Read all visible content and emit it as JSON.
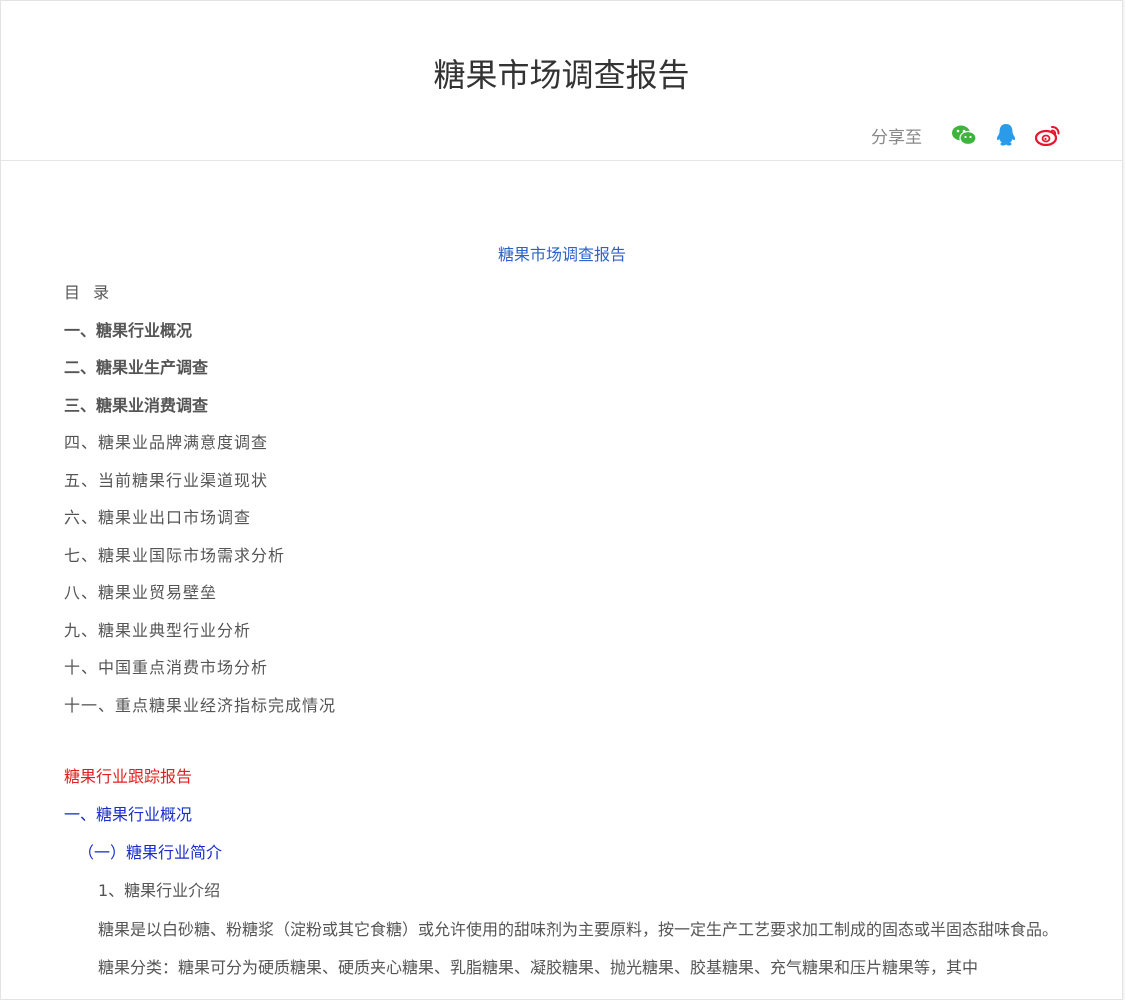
{
  "header": {
    "title": "糖果市场调查报告",
    "share_label": "分享至",
    "share_icons": [
      "wechat-icon",
      "qq-icon",
      "weibo-icon"
    ],
    "colors": {
      "wechat": "#3bb53b",
      "qq": "#2a9be8",
      "weibo": "#e6162d"
    }
  },
  "content": {
    "center_title": "糖果市场调查报告",
    "toc_label": "目 录",
    "toc": [
      "一、糖果行业概况",
      "二、糖果业生产调查",
      "三、糖果业消费调查",
      "四、糖果业品牌满意度调查",
      "五、当前糖果行业渠道现状",
      "六、糖果业出口市场调查",
      "七、糖果业国际市场需求分析",
      "八、糖果业贸易壁垒",
      "九、糖果业典型行业分析",
      "十、中国重点消费市场分析",
      "十一、重点糖果业经济指标完成情况"
    ],
    "tracking_title": "糖果行业跟踪报告",
    "section_title": "一、糖果行业概况",
    "subsection_title": "（一）糖果行业简介",
    "item_title": "1、糖果行业介绍",
    "paragraph_1": "糖果是以白砂糖、粉糖浆（淀粉或其它食糖）或允许使用的甜味剂为主要原料，按一定生产工艺要求加工制成的固态或半固态甜味食品。",
    "paragraph_2": "糖果分类：糖果可分为硬质糖果、硬质夹心糖果、乳脂糖果、凝胶糖果、抛光糖果、胶基糖果、充气糖果和压片糖果等，其中"
  }
}
